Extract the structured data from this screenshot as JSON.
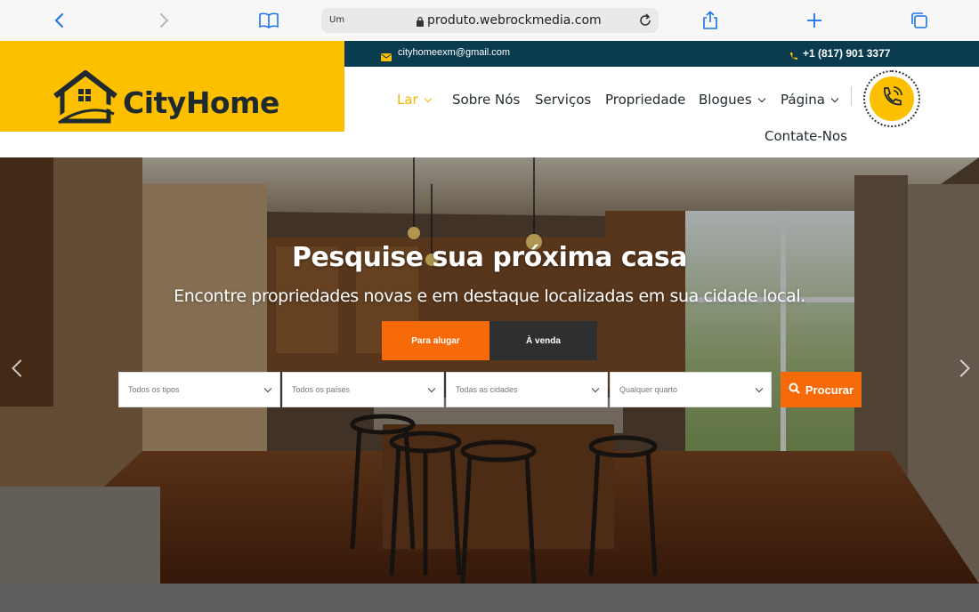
{
  "browser": {
    "url_prefix": "Um",
    "url": "produto.webrockmedia.com"
  },
  "brand": {
    "logo_text": "CityHome",
    "accent": "#fcc000",
    "dark": "#0a3b4f",
    "orange": "#f66a0a"
  },
  "topbar": {
    "email": "cityhomeexm@gmail.com",
    "phone": "+1 (817) 901 3377"
  },
  "nav": {
    "items": [
      {
        "label": "Lar",
        "has_caret": true,
        "active": true
      },
      {
        "label": "Sobre Nós",
        "has_caret": false
      },
      {
        "label": "Serviços",
        "has_caret": false
      },
      {
        "label": "Propriedade",
        "has_caret": false
      },
      {
        "label": "Blogues",
        "has_caret": true
      },
      {
        "label": "Página",
        "has_caret": true
      },
      {
        "label": "Contate-Nos",
        "has_caret": false
      }
    ]
  },
  "hero": {
    "title": "Pesquise sua próxima casa",
    "subtitle": "Encontre propriedades novas e em destaque localizadas em sua cidade local.",
    "tabs": [
      "Para alugar",
      "À venda"
    ],
    "filters": [
      "Todos os tipos",
      "Todos os países",
      "Todas as cidades",
      "Qualquer quarto"
    ],
    "search_label": "Procurar"
  },
  "icons": {
    "back": "chevron-left-icon",
    "forward": "chevron-right-icon",
    "bookmarks": "book-icon",
    "reload": "reload-icon",
    "share": "share-icon",
    "new_tab": "plus-icon",
    "tabs": "tabs-icon",
    "email": "envelope-icon",
    "phone": "phone-icon",
    "search": "search-icon"
  }
}
